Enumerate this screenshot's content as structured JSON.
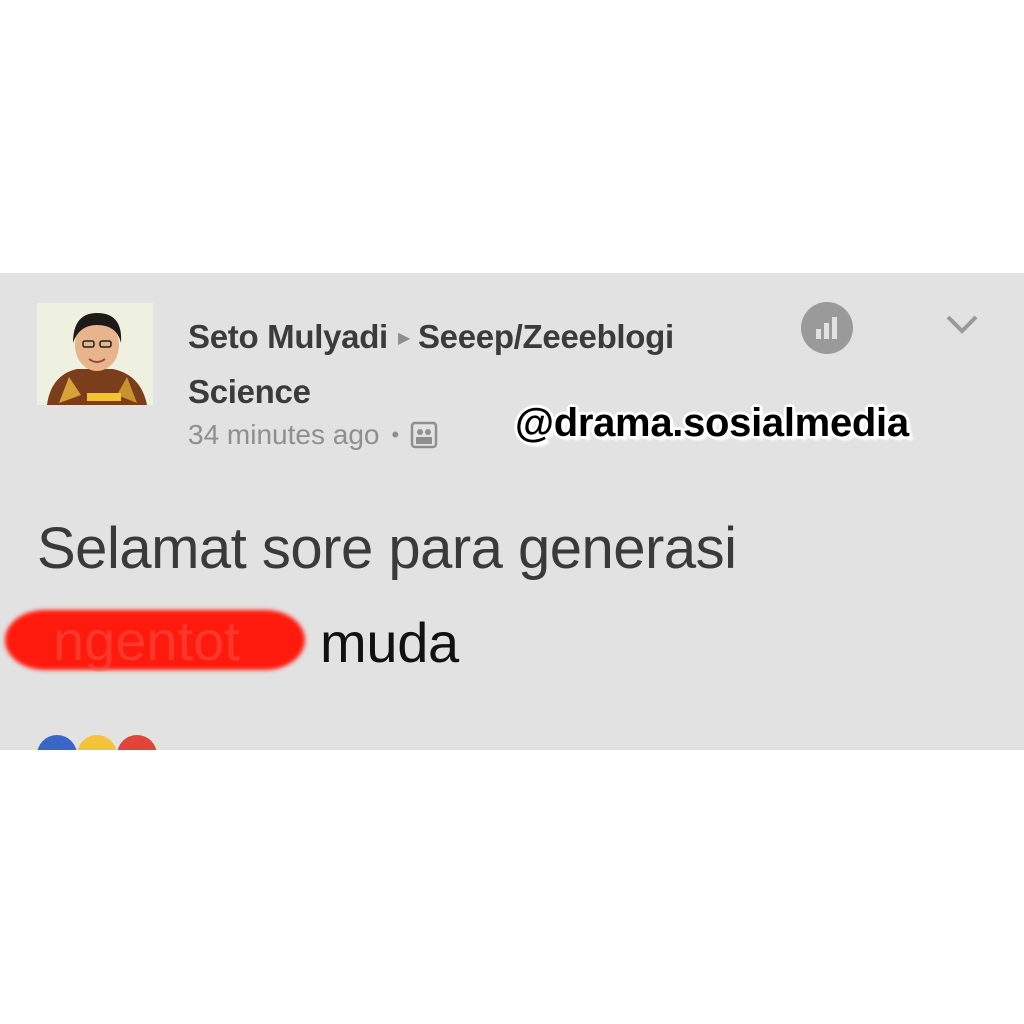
{
  "post": {
    "author": "Seto Mulyadi",
    "group": "Seeep/Zeeeblogi Science",
    "timestamp": "34 minutes ago",
    "message_line1": "Selamat sore para generasi",
    "redacted_word": "ngentot",
    "message_line2_end": "muda"
  },
  "watermark": "@drama.sosialmedia",
  "icons": {
    "avatar": "profile-photo",
    "separator": "right-triangle-icon",
    "privacy": "group-icon",
    "insights": "bar-chart-icon",
    "menu": "chevron-down-icon"
  },
  "colors": {
    "post_bg": "#e2e2e2",
    "redaction": "#ff1a0e",
    "like": "#3b66c8",
    "haha": "#f5c33b",
    "angry": "#e0443a"
  }
}
